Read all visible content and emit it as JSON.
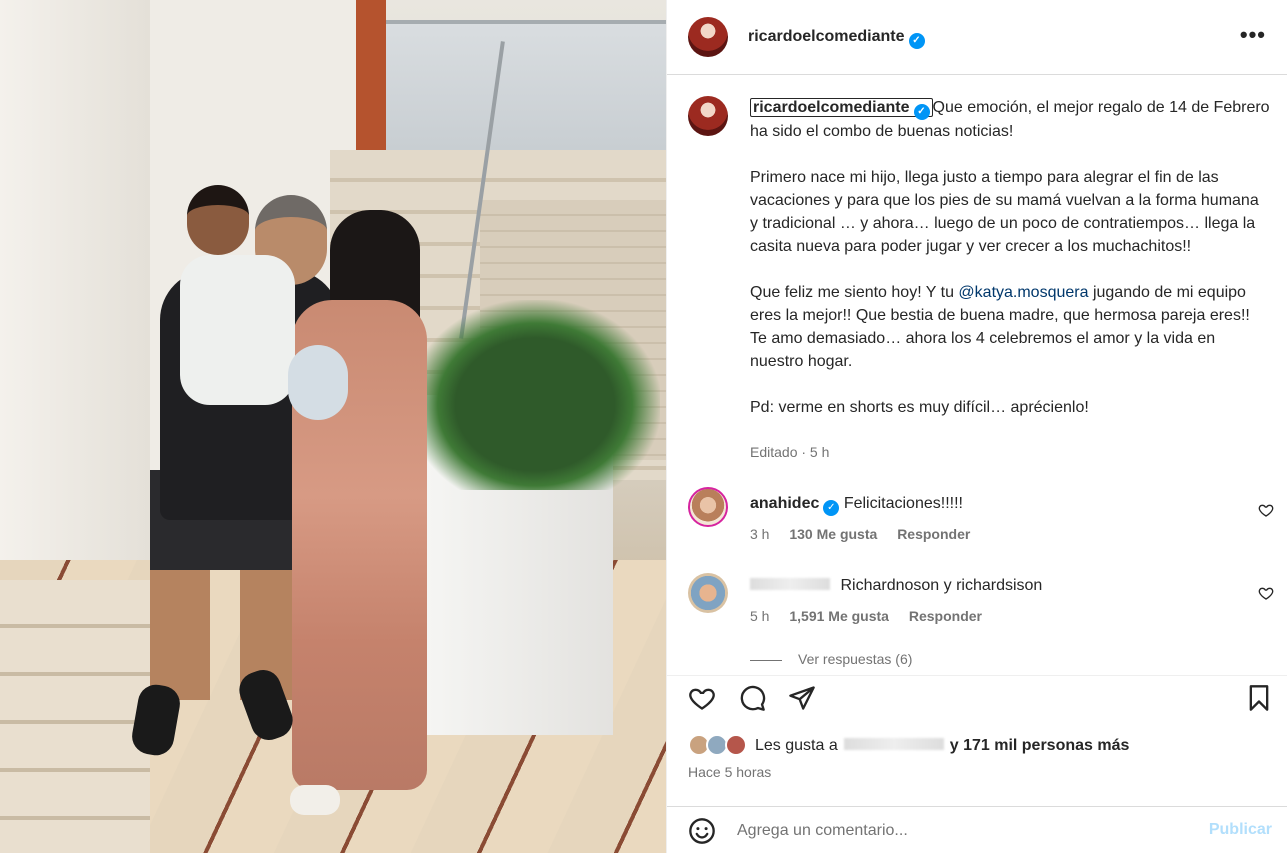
{
  "post": {
    "username": "ricardoelcomediante",
    "more_label": "•••",
    "caption_username": "ricardoelcomediante",
    "caption_p1": "Que emoción, el mejor regalo de 14 de Febrero ha sido el combo de buenas noticias!",
    "caption_p2": "Primero nace mi hijo, llega justo a tiempo para alegrar el fin de las vacaciones y para que los pies de su mamá vuelvan a la forma humana y tradicional … y ahora… luego de un poco de contratiempos… llega la casita nueva para poder jugar y ver crecer a los muchachitos!!",
    "caption_p3_before": "Que feliz me siento hoy! Y tu ",
    "caption_mention": "@katya.mosquera",
    "caption_p3_after": " jugando de mi equipo eres la mejor!! Que bestia de buena madre, que hermosa pareja eres!! Te amo demasiado… ahora los 4 celebremos el amor y la vida en nuestro hogar.",
    "caption_p4": "Pd: verme en shorts es muy difícil… aprécienlo!",
    "edited": "Editado · 5 h"
  },
  "comments": [
    {
      "username": "anahidec",
      "text": "Felicitaciones!!!!!",
      "time": "3 h",
      "likes": "130 Me gusta",
      "reply": "Responder"
    },
    {
      "username": "",
      "text": "Richardnoson y richardsison",
      "time": "5 h",
      "likes": "1,591 Me gusta",
      "reply": "Responder",
      "replies": "Ver respuestas (6)"
    }
  ],
  "footer": {
    "likes_prefix": "Les gusta a",
    "likes_suffix": "y 171 mil personas más",
    "time": "Hace 5 horas",
    "comment_placeholder": "Agrega un comentario...",
    "publish": "Publicar"
  },
  "colors": {
    "verified": "#0095f6",
    "link": "#00376b",
    "publish_disabled": "#b2dffc",
    "secondary_text": "#737373"
  },
  "icons": [
    "verified-icon",
    "more-icon",
    "heart-icon",
    "comment-icon",
    "share-icon",
    "bookmark-icon",
    "emoji-icon"
  ]
}
